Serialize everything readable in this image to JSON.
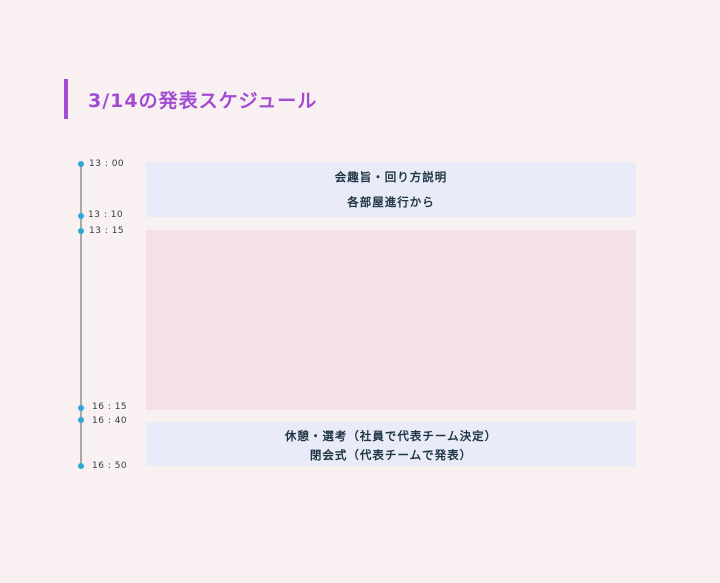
{
  "title": "3/14の発表スケジュール",
  "colors": {
    "background": "#f9f1f1",
    "accent": "#a24bd3",
    "dot": "#2ea9d6",
    "block_blue": "#e9ecf8",
    "block_pink": "#f3e1e5"
  },
  "timeline": {
    "times": [
      "13 : 00",
      "13 : 10",
      "13 : 15",
      "16 : 15",
      "16 : 40",
      "16 : 50"
    ]
  },
  "blocks": [
    {
      "lines": [
        "会趣旨・回り方説明",
        "各部屋進行から"
      ]
    },
    {
      "lines": []
    },
    {
      "lines": [
        "休憩・選考（社員で代表チーム決定）",
        "閉会式（代表チームで発表）"
      ]
    }
  ]
}
